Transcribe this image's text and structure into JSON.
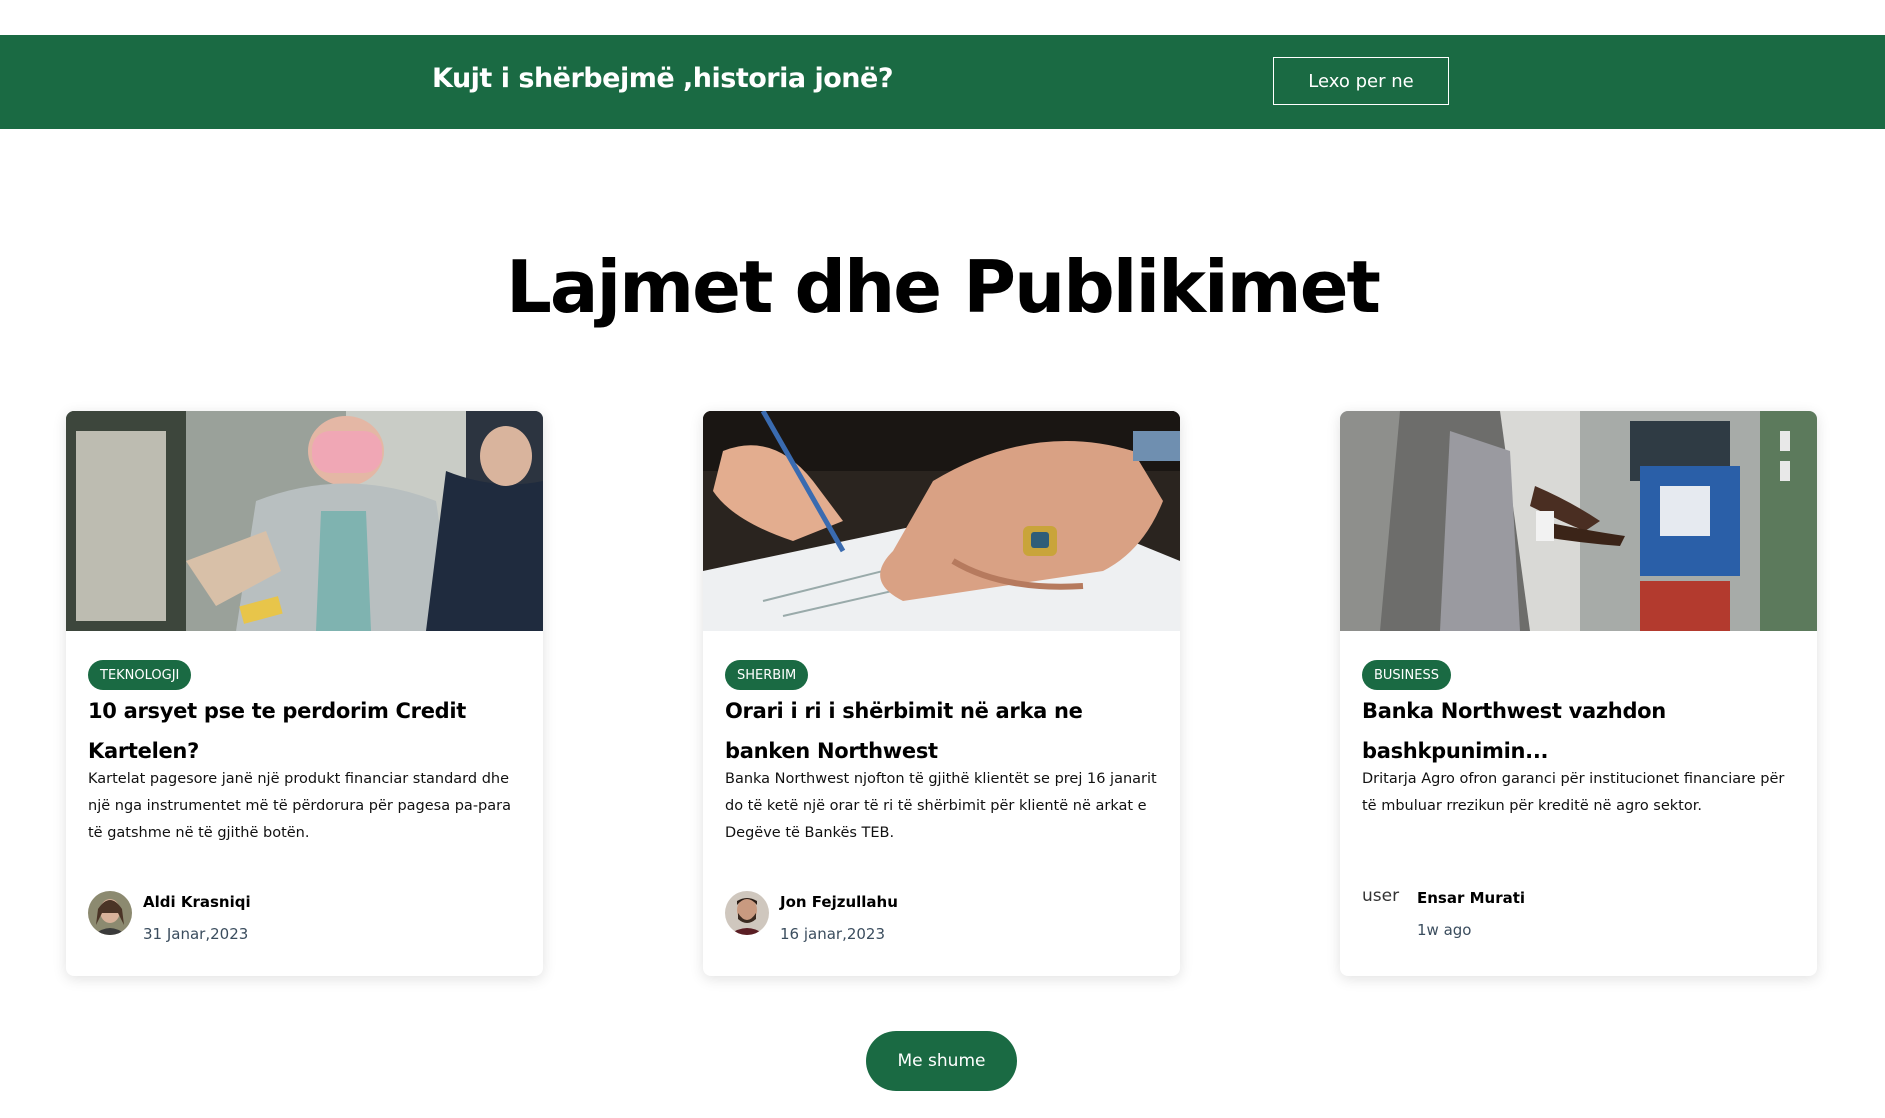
{
  "banner": {
    "title": "Kujt i shërbejmë ,historia jonë?",
    "button_label": "Lexo per ne",
    "background": "#1a6a43"
  },
  "section": {
    "title": "Lajmet dhe Publikimet"
  },
  "cards": [
    {
      "tag": "TEKNOLOGJI",
      "title": "10 arsyet pse te perdorim Credit Kartelen?",
      "text": "Kartelat pagesore janë një produkt financiar standard dhe një nga instrumentet më të përdorura për pagesa pa-para të gatshme në të gjithë botën.",
      "author": "Aldi Krasniqi",
      "date": "31 Janar,2023",
      "image": "card-payment-photo"
    },
    {
      "tag": "SHERBIM",
      "title": "Orari i ri i shërbimit në arka ne banken Northwest",
      "text": "Banka Northwest njofton të gjithë klientët se prej 16 janarit do të ketë një orar të ri të shërbimit për klientë në arkat e Degëve të Bankës TEB.",
      "author": "Jon Fejzullahu",
      "date": "16 janar,2023",
      "image": "signing-document-photo"
    },
    {
      "tag": "BUSINESS",
      "title": "Banka Northwest vazhdon bashkpunimin...",
      "text": "Dritarja Agro ofron garanci për institucionet financiare për të mbuluar rrezikun për kreditë në agro sektor.",
      "author": "Ensar Murati",
      "date": "1w ago",
      "image": "atm-photo",
      "avatar_alt": "user"
    }
  ],
  "more_button": {
    "label": "Me shume"
  }
}
